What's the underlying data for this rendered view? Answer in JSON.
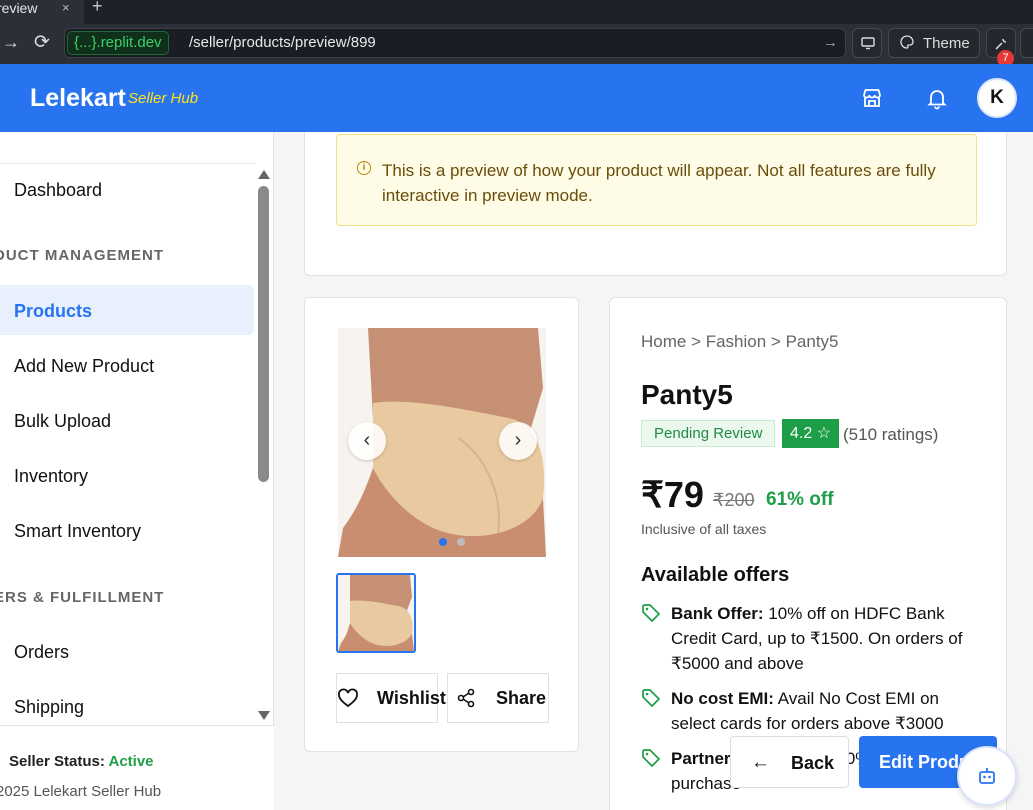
{
  "browser": {
    "tab_title": "review",
    "tab_close": "×",
    "new_tab": "+",
    "url_host": "{...}.replit.dev",
    "url_path": "/seller/products/preview/899",
    "theme_label": "Theme",
    "notification_count": "7"
  },
  "header": {
    "brand": "Lelekart",
    "brand_sub": "Seller Hub",
    "avatar_initial": "K"
  },
  "sidebar": {
    "dashboard": "Dashboard",
    "section_product": "DUCT MANAGEMENT",
    "products": "Products",
    "add_new": "Add New Product",
    "bulk_upload": "Bulk Upload",
    "inventory": "Inventory",
    "smart_inventory": "Smart Inventory",
    "section_orders": "ERS & FULFILLMENT",
    "orders": "Orders",
    "shipping": "Shipping",
    "status_label": "Seller Status:",
    "status_value": "Active",
    "copyright": "2025 Lelekart Seller Hub"
  },
  "notice": {
    "text": "This is a preview of how your product will appear. Not all features are fully interactive in preview mode."
  },
  "gallery": {
    "wishlist": "Wishlist",
    "share": "Share",
    "active_slide": 1,
    "slide_count": 2
  },
  "product": {
    "breadcrumb": "Home > Fashion > Panty5",
    "title": "Panty5",
    "status": "Pending Review",
    "rating": "4.2 ☆",
    "rating_count": "(510 ratings)",
    "price": "₹79",
    "mrp": "₹200",
    "discount": "61% off",
    "taxes": "Inclusive of all taxes",
    "offers_heading": "Available offers",
    "offers": [
      {
        "title": "Bank Offer:",
        "text": " 10% off on HDFC Bank Credit Card, up to ₹1500. On orders of ₹5000 and above"
      },
      {
        "title": "No cost EMI:",
        "text": " Avail No Cost EMI on select cards for orders above ₹3000"
      },
      {
        "title": "Partner",
        "text": " in save up to 20% on business purchase"
      }
    ]
  },
  "actions": {
    "back": "Back",
    "edit": "Edit Product"
  },
  "colors": {
    "brand_blue": "#2874f0",
    "brand_yellow": "#ffe11b",
    "success_green": "#1e9e47"
  }
}
